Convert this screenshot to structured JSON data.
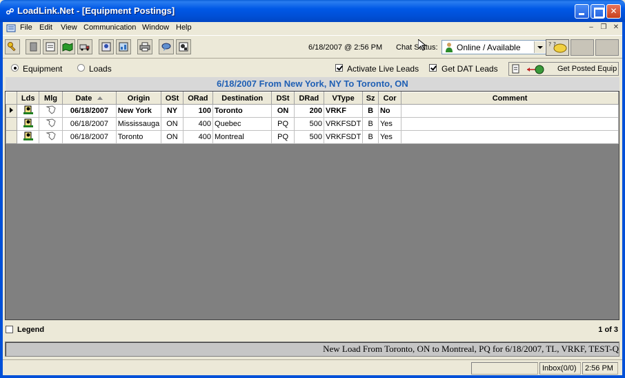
{
  "window": {
    "title": "LoadLink.Net - [Equipment Postings]"
  },
  "menu": [
    "File",
    "Edit",
    "View",
    "Communication",
    "Window",
    "Help"
  ],
  "toolbar": {
    "datetime": "6/18/2007 @ 2:56 PM",
    "chat_status_label": "Chat Status:",
    "chat_status_value": "Online / Available"
  },
  "filters": {
    "equipment_label": "Equipment",
    "loads_label": "Loads",
    "activate_live_leads_label": "Activate Live Leads",
    "get_dat_leads_label": "Get DAT Leads",
    "get_posted_equip_label": "Get Posted Equip"
  },
  "route_header": "6/18/2007 From New York, NY To Toronto, ON",
  "grid": {
    "columns": [
      "Lds",
      "Mlg",
      "Date",
      "Origin",
      "OSt",
      "ORad",
      "Destination",
      "DSt",
      "DRad",
      "VType",
      "Sz",
      "Cor",
      "Comment"
    ],
    "rows": [
      {
        "date": "06/18/2007",
        "origin": "New York",
        "ost": "NY",
        "orad": "100",
        "destination": "Toronto",
        "dst": "ON",
        "drad": "200",
        "vtype": "VRKF",
        "sz": "B",
        "cor": "No",
        "comment": ""
      },
      {
        "date": "06/18/2007",
        "origin": "Mississauga",
        "ost": "ON",
        "orad": "400",
        "destination": "Quebec",
        "dst": "PQ",
        "drad": "500",
        "vtype": "VRKFSDT",
        "sz": "B",
        "cor": "Yes",
        "comment": ""
      },
      {
        "date": "06/18/2007",
        "origin": "Toronto",
        "ost": "ON",
        "orad": "400",
        "destination": "Montreal",
        "dst": "PQ",
        "drad": "500",
        "vtype": "VRKFSDT",
        "sz": "B",
        "cor": "Yes",
        "comment": ""
      }
    ]
  },
  "legend_label": "Legend",
  "pager": "1 of 3",
  "ticker": "New Load From Toronto, ON to Montreal, PQ for 6/18/2007, TL, VRKF, TEST-Q",
  "statusbar": {
    "inbox": "Inbox(0/0)",
    "time": "2:56 PM"
  },
  "colors": {
    "titlebar": "#0058e6",
    "route_header_text": "#1f5fb4",
    "grid_empty": "#808080"
  }
}
